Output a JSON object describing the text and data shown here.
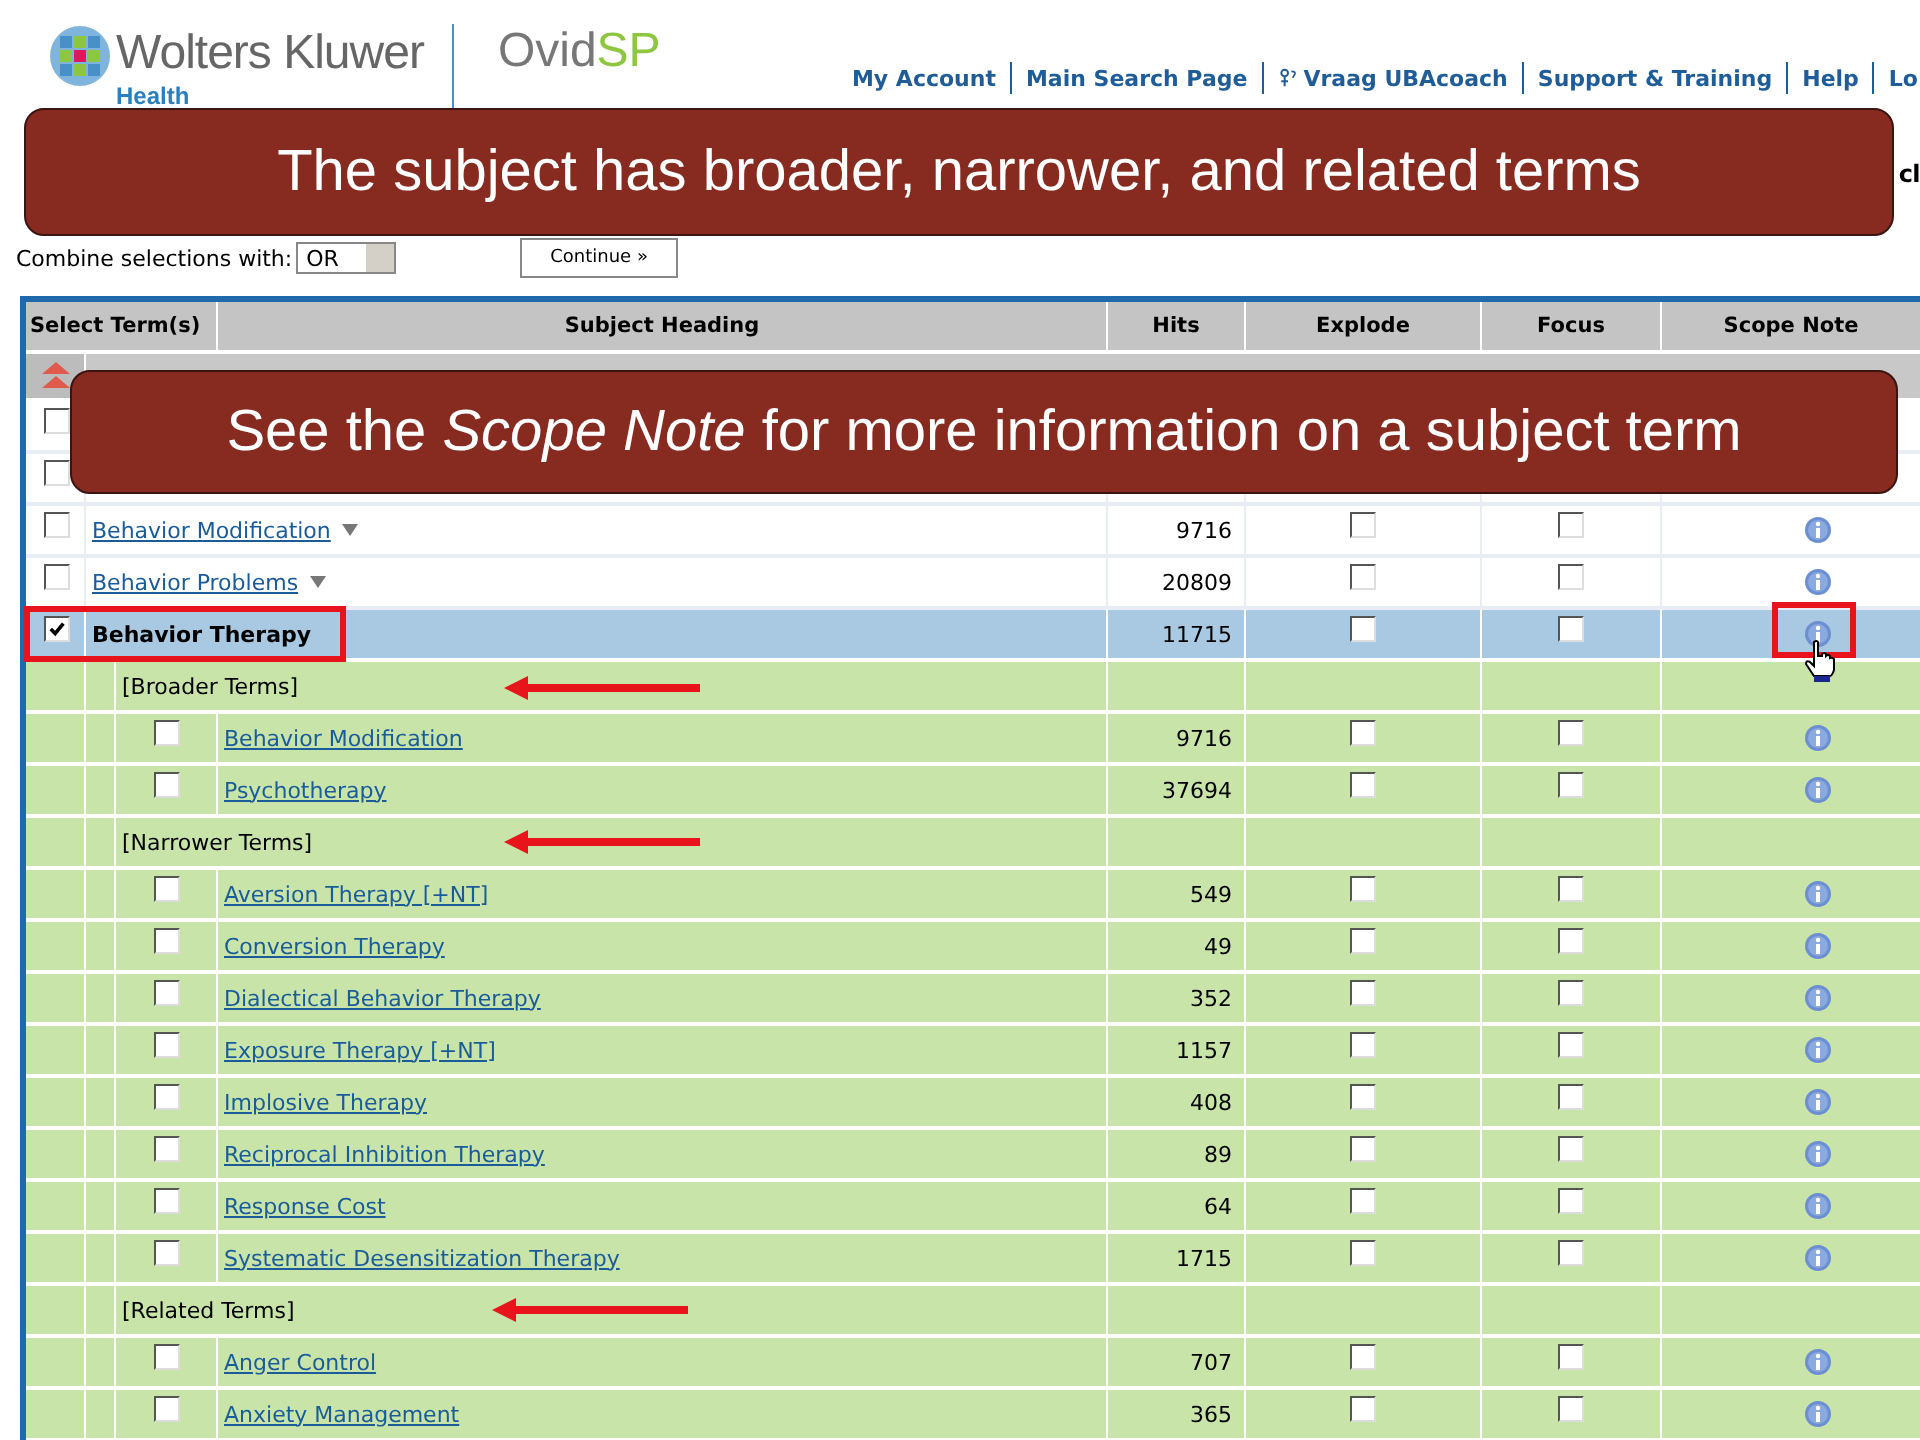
{
  "header": {
    "brand": "Wolters Kluwer",
    "division": "Health",
    "product": "Ovid",
    "product_suffix": "SP",
    "nav": [
      {
        "label": "My Account",
        "icon": false
      },
      {
        "label": "Main Search Page",
        "icon": false
      },
      {
        "label": "Vraag UBAcoach",
        "icon": true
      },
      {
        "label": "Support & Training",
        "icon": false
      },
      {
        "label": "Help",
        "icon": false
      },
      {
        "label": "Lo",
        "icon": false
      }
    ],
    "heading_fragment": "cl"
  },
  "combine": {
    "label": "Combine selections with:",
    "value": "OR",
    "button": "Continue »"
  },
  "table": {
    "columns": [
      "Select Term(s)",
      "Subject Heading",
      "Hits",
      "Explode",
      "Focus",
      "Scope Note"
    ],
    "rows": [
      {
        "kind": "covered",
        "checked": false
      },
      {
        "kind": "covered",
        "checked": false
      },
      {
        "kind": "term",
        "name": "Behavior Modification",
        "hits": "9716",
        "checked": false,
        "selected": false,
        "has_menu": true,
        "explode": false,
        "focus": false
      },
      {
        "kind": "term",
        "name": "Behavior Problems",
        "hits": "20809",
        "checked": false,
        "selected": false,
        "has_menu": true,
        "explode": false,
        "focus": false
      },
      {
        "kind": "term",
        "name": "Behavior Therapy",
        "hits": "11715",
        "checked": true,
        "selected": true,
        "has_menu": false,
        "explode": false,
        "focus": false
      },
      {
        "kind": "section",
        "label": "[Broader Terms]"
      },
      {
        "kind": "sub",
        "name": "Behavior Modification",
        "hits": "9716",
        "checked": false,
        "explode": false,
        "focus": false
      },
      {
        "kind": "sub",
        "name": "Psychotherapy",
        "hits": "37694",
        "checked": false,
        "explode": false,
        "focus": false
      },
      {
        "kind": "section",
        "label": "[Narrower Terms]"
      },
      {
        "kind": "sub",
        "name": "Aversion Therapy [+NT]",
        "hits": "549",
        "checked": false,
        "explode": false,
        "focus": false
      },
      {
        "kind": "sub",
        "name": "Conversion Therapy",
        "hits": "49",
        "checked": false,
        "explode": false,
        "focus": false
      },
      {
        "kind": "sub",
        "name": "Dialectical Behavior Therapy",
        "hits": "352",
        "checked": false,
        "explode": false,
        "focus": false
      },
      {
        "kind": "sub",
        "name": "Exposure Therapy [+NT]",
        "hits": "1157",
        "checked": false,
        "explode": false,
        "focus": false
      },
      {
        "kind": "sub",
        "name": "Implosive Therapy",
        "hits": "408",
        "checked": false,
        "explode": false,
        "focus": false
      },
      {
        "kind": "sub",
        "name": "Reciprocal Inhibition Therapy",
        "hits": "89",
        "checked": false,
        "explode": false,
        "focus": false
      },
      {
        "kind": "sub",
        "name": "Response Cost",
        "hits": "64",
        "checked": false,
        "explode": false,
        "focus": false
      },
      {
        "kind": "sub",
        "name": "Systematic Desensitization Therapy",
        "hits": "1715",
        "checked": false,
        "explode": false,
        "focus": false
      },
      {
        "kind": "section",
        "label": "[Related Terms]"
      },
      {
        "kind": "sub",
        "name": "Anger Control",
        "hits": "707",
        "checked": false,
        "explode": false,
        "focus": false
      },
      {
        "kind": "sub",
        "name": "Anxiety Management",
        "hits": "365",
        "checked": false,
        "explode": false,
        "focus": false
      }
    ]
  },
  "callouts": [
    "The subject has broader, narrower, and related terms",
    "See the *Scope Note* for more information on a subject term"
  ]
}
